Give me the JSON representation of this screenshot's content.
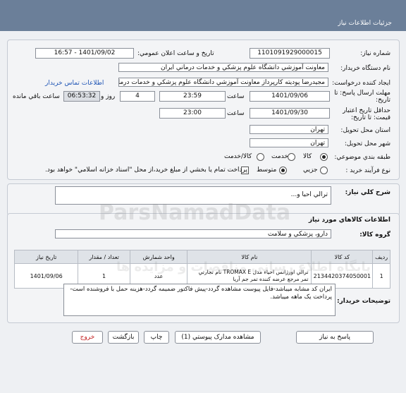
{
  "header": {
    "title": "جزئيات اطلاعات نياز"
  },
  "form": {
    "need_number_label": "شماره نياز:",
    "need_number": "1101091929000015",
    "announce_label": "تاريخ و ساعت اعلان عمومي:",
    "announce_value": "1401/09/02 - 16:57",
    "buyer_label": "نام دستگاه خريدار:",
    "buyer_value": "معاونت آموزشي دانشگاه علوم پزشکي و خدمات درماني ايران",
    "creator_label": "ايجاد کننده درخواست:",
    "creator_value": "مجيدرضا پوديته کارپرداز معاونت آموزشي دانشگاه علوم پزشکي و خدمات درماني ايران",
    "contact_link": "اطلاعات تماس خريدار",
    "deadline_label_line1": "مهلت ارسال پاسخ: تا",
    "deadline_label_line2": "تاريخ:",
    "deadline_date": "1401/09/06",
    "hour_label": "ساعت",
    "deadline_time": "23:59",
    "days_value": "4",
    "days_label": "روز و",
    "remaining_time": "06:53:32",
    "remaining_label": "ساعت باقي مانده",
    "validity_label_line1": "حداقل تاريخ اعتبار",
    "validity_label_line2": "قيمت: تا تاريخ:",
    "validity_date": "1401/09/30",
    "validity_hour_label": "ساعت",
    "validity_time": "23:00",
    "province_label": "استان محل تحويل:",
    "province_value": "تهران",
    "city_label": "شهر محل تحويل:",
    "city_value": "تهران",
    "category_label": "طبقه بندي موضوعي:",
    "category_options": [
      "کالا",
      "خدمت",
      "کالا/خدمت"
    ],
    "purchase_label": "نوع فرآيند خريد :",
    "purchase_options": [
      "جزيي",
      "متوسط"
    ],
    "payment_note": "پرداخت تمام يا بخشي از مبلغ خريد،از محل \"اسناد خزانه اسلامي\" خواهد بود."
  },
  "summary": {
    "label": "شرح کلي نياز:",
    "value": "ترالي احيا و..."
  },
  "goods": {
    "section_title": "اطلاعات کالاهاي مورد نياز",
    "group_label": "گروه کالا:",
    "group_value": "دارو، پزشکي و سلامت",
    "columns": [
      "رديف",
      "کد کالا",
      "نام کالا",
      "واحد شمارش",
      "تعداد / مقدار",
      "تاريخ نياز"
    ],
    "rows": [
      {
        "row": "1",
        "code": "2134420374050001",
        "name": "ترالي اورژانس احياء مدل TROMAX E نام تجارتي تمر مرجع عرضه کننده تمر جم آريا",
        "unit": "عدد",
        "qty": "1",
        "date": "1401/09/06"
      }
    ]
  },
  "notes": {
    "label": "توضيحات خريدار:",
    "value": "ايران کد مشابه ميباشد-فايل پيوست مشاهده گردد-پيش فاکتور ضميمه گردد-هزينه حمل با فروشنده است-پرداخت يک ماهه ميباشد."
  },
  "buttons": {
    "reply": "پاسخ به نياز",
    "attachments": "مشاهده مدارک پيوستي (1)",
    "print": "چاپ",
    "back": "بازگشت",
    "exit": "خروج"
  },
  "watermark": {
    "brand": "ParsNamadData",
    "tagline": "پايگاه اطلاع رساني مناقصات و مزايده ها"
  }
}
